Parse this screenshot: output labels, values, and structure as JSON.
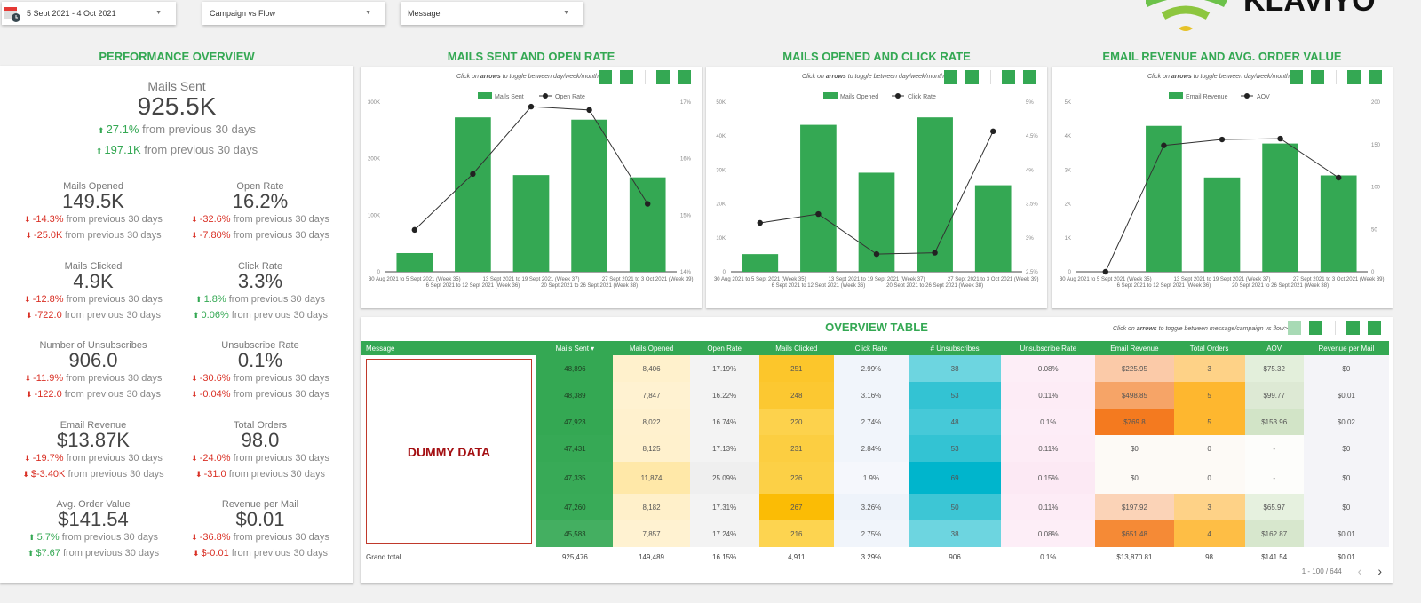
{
  "filters": {
    "date_range": "5 Sept 2021 - 4 Oct 2021",
    "type": "Campaign vs Flow",
    "message": "Message"
  },
  "logo": {
    "text": "KLAVIYO"
  },
  "performance": {
    "title": "PERFORMANCE OVERVIEW",
    "mails_sent": {
      "label": "Mails Sent",
      "value": "925.5K",
      "changes": [
        {
          "dir": "up",
          "value": "27.1%",
          "text": "from previous 30 days"
        },
        {
          "dir": "up",
          "value": "197.1K",
          "text": "from previous 30 days"
        }
      ]
    },
    "kpis": [
      {
        "label": "Mails Opened",
        "value": "149.5K",
        "changes": [
          {
            "dir": "dn",
            "value": "-14.3%",
            "text": "from previous 30 days"
          },
          {
            "dir": "dn",
            "value": "-25.0K",
            "text": "from previous 30 days"
          }
        ]
      },
      {
        "label": "Open Rate",
        "value": "16.2%",
        "changes": [
          {
            "dir": "dn",
            "value": "-32.6%",
            "text": "from previous 30 days"
          },
          {
            "dir": "dn",
            "value": "-7.80%",
            "text": "from previous 30 days"
          }
        ]
      },
      {
        "label": "Mails Clicked",
        "value": "4.9K",
        "changes": [
          {
            "dir": "dn",
            "value": "-12.8%",
            "text": "from previous 30 days"
          },
          {
            "dir": "dn",
            "value": "-722.0",
            "text": "from previous 30 days"
          }
        ]
      },
      {
        "label": "Click Rate",
        "value": "3.3%",
        "changes": [
          {
            "dir": "up",
            "value": "1.8%",
            "text": "from previous 30 days"
          },
          {
            "dir": "up",
            "value": "0.06%",
            "text": "from previous 30 days"
          }
        ]
      },
      {
        "label": "Number of Unsubscribes",
        "value": "906.0",
        "changes": [
          {
            "dir": "dn",
            "value": "-11.9%",
            "text": "from previous 30 days"
          },
          {
            "dir": "dn",
            "value": "-122.0",
            "text": "from previous 30 days"
          }
        ]
      },
      {
        "label": "Unsubscribe Rate",
        "value": "0.1%",
        "changes": [
          {
            "dir": "dn",
            "value": "-30.6%",
            "text": "from previous 30 days"
          },
          {
            "dir": "dn",
            "value": "-0.04%",
            "text": "from previous 30 days"
          }
        ]
      },
      {
        "label": "Email Revenue",
        "value": "$13.87K",
        "changes": [
          {
            "dir": "dn",
            "value": "-19.7%",
            "text": "from previous 30 days"
          },
          {
            "dir": "dn",
            "value": "$-3.40K",
            "text": "from previous 30 days"
          }
        ]
      },
      {
        "label": "Total Orders",
        "value": "98.0",
        "changes": [
          {
            "dir": "dn",
            "value": "-24.0%",
            "text": "from previous 30 days"
          },
          {
            "dir": "dn",
            "value": "-31.0",
            "text": "from previous 30 days"
          }
        ]
      },
      {
        "label": "Avg. Order Value",
        "value": "$141.54",
        "changes": [
          {
            "dir": "up",
            "value": "5.7%",
            "text": "from previous 30 days"
          },
          {
            "dir": "up",
            "value": "$7.67",
            "text": "from previous 30 days"
          }
        ]
      },
      {
        "label": "Revenue per Mail",
        "value": "$0.01",
        "changes": [
          {
            "dir": "dn",
            "value": "-36.8%",
            "text": "from previous 30 days"
          },
          {
            "dir": "dn",
            "value": "$-0.01",
            "text": "from previous 30 days"
          }
        ]
      }
    ]
  },
  "chart_hint": {
    "pre": "Click on ",
    "bold": "arrows",
    "post": " to toggle between day/week/month >"
  },
  "chart_data": [
    {
      "type": "bar",
      "title": "MAILS SENT AND OPEN RATE",
      "categories": [
        "30 Aug 2021 to 5 Sept 2021 (Week 35)",
        "6 Sept 2021 to 12 Sept 2021 (Week 36)",
        "13 Sept 2021 to 19 Sept 2021 (Week 37)",
        "20 Sept 2021 to 26 Sept 2021 (Week 38)",
        "27 Sept 2021 to 3 Oct 2021 (Week 39)"
      ],
      "series": [
        {
          "name": "Mails Sent",
          "type": "bar",
          "axis": "left",
          "values": [
            33000,
            273000,
            171000,
            269000,
            167000
          ]
        },
        {
          "name": "Open Rate",
          "type": "line",
          "axis": "right",
          "values": [
            14.74,
            15.73,
            16.92,
            16.86,
            15.2
          ]
        }
      ],
      "y_left": {
        "range": [
          0,
          300000
        ],
        "ticks": [
          "0",
          "100K",
          "200K",
          "300K"
        ]
      },
      "y_right": {
        "range": [
          14,
          17
        ],
        "ticks": [
          "14%",
          "15%",
          "16%",
          "17%"
        ]
      },
      "legend": "top-center",
      "grid": false
    },
    {
      "type": "bar",
      "title": "MAILS OPENED AND CLICK RATE",
      "categories": [
        "30 Aug 2021 to 5 Sept 2021 (Week 35)",
        "6 Sept 2021 to 12 Sept 2021 (Week 36)",
        "13 Sept 2021 to 19 Sept 2021 (Week 37)",
        "20 Sept 2021 to 26 Sept 2021 (Week 38)",
        "27 Sept 2021 to 3 Oct 2021 (Week 39)"
      ],
      "series": [
        {
          "name": "Mails Opened",
          "type": "bar",
          "axis": "left",
          "values": [
            5200,
            43300,
            29200,
            45500,
            25500
          ]
        },
        {
          "name": "Click Rate",
          "type": "line",
          "axis": "right",
          "values": [
            3.22,
            3.35,
            2.76,
            2.78,
            4.57
          ]
        }
      ],
      "y_left": {
        "range": [
          0,
          50000
        ],
        "ticks": [
          "0",
          "10K",
          "20K",
          "30K",
          "40K",
          "50K"
        ]
      },
      "y_right": {
        "range": [
          2.5,
          5
        ],
        "ticks": [
          "2.5%",
          "3%",
          "3.5%",
          "4%",
          "4.5%",
          "5%"
        ]
      },
      "legend": "top-center",
      "grid": false
    },
    {
      "type": "bar",
      "title": "EMAIL REVENUE AND AVG. ORDER VALUE",
      "categories": [
        "30 Aug 2021 to 5 Sept 2021 (Week 35)",
        "6 Sept 2021 to 12 Sept 2021 (Week 36)",
        "13 Sept 2021 to 19 Sept 2021 (Week 37)",
        "20 Sept 2021 to 26 Sept 2021 (Week 38)",
        "27 Sept 2021 to 3 Oct 2021 (Week 39)"
      ],
      "series": [
        {
          "name": "Email Revenue",
          "type": "bar",
          "axis": "left",
          "values": [
            0,
            4300,
            2780,
            3780,
            2840
          ]
        },
        {
          "name": "AOV",
          "type": "line",
          "axis": "right",
          "values": [
            0,
            149,
            156,
            157,
            111
          ]
        }
      ],
      "y_left": {
        "range": [
          0,
          5000
        ],
        "ticks": [
          "0",
          "1K",
          "2K",
          "3K",
          "4K",
          "5K"
        ]
      },
      "y_right": {
        "range": [
          0,
          200
        ],
        "ticks": [
          "0",
          "50",
          "100",
          "150",
          "200"
        ]
      },
      "legend": "top-center",
      "grid": false
    }
  ],
  "table": {
    "title": "OVERVIEW TABLE",
    "hint": {
      "pre": "Click on ",
      "bold": "arrows",
      "post": " to toggle between message/campaign vs flow>"
    },
    "placeholder": "DUMMY DATA",
    "columns": [
      "Message",
      "Mails Sent ▾",
      "Mails Opened",
      "Open Rate",
      "Mails Clicked",
      "Click Rate",
      "# Unsubscribes",
      "Unsubscribe Rate",
      "Email Revenue",
      "Total Orders",
      "AOV",
      "Revenue per Mail"
    ],
    "rows": [
      [
        "",
        "48,896",
        "8,406",
        "17.19%",
        "251",
        "2.99%",
        "38",
        "0.08%",
        "$225.95",
        "3",
        "$75.32",
        "$0"
      ],
      [
        "",
        "48,389",
        "7,847",
        "16.22%",
        "248",
        "3.16%",
        "53",
        "0.11%",
        "$498.85",
        "5",
        "$99.77",
        "$0.01"
      ],
      [
        "",
        "47,923",
        "8,022",
        "16.74%",
        "220",
        "2.74%",
        "48",
        "0.1%",
        "$769.8",
        "5",
        "$153.96",
        "$0.02"
      ],
      [
        "",
        "47,431",
        "8,125",
        "17.13%",
        "231",
        "2.84%",
        "53",
        "0.11%",
        "$0",
        "0",
        "-",
        "$0"
      ],
      [
        "",
        "47,335",
        "11,874",
        "25.09%",
        "226",
        "1.9%",
        "69",
        "0.15%",
        "$0",
        "0",
        "-",
        "$0"
      ],
      [
        "",
        "47,260",
        "8,182",
        "17.31%",
        "267",
        "3.26%",
        "50",
        "0.11%",
        "$197.92",
        "3",
        "$65.97",
        "$0"
      ],
      [
        "",
        "45,583",
        "7,857",
        "17.24%",
        "216",
        "2.75%",
        "38",
        "0.08%",
        "$651.48",
        "4",
        "$162.87",
        "$0.01"
      ]
    ],
    "grand_total": [
      "Grand total",
      "925,476",
      "149,489",
      "16.15%",
      "4,911",
      "3.29%",
      "906",
      "0.1%",
      "$13,870.81",
      "98",
      "$141.54",
      "$0.01"
    ],
    "pagination": {
      "range": "1 - 100 / 644",
      "prev": "‹",
      "next": "›"
    }
  },
  "colors": {
    "accent": "#34a853",
    "up": "#34a853",
    "down": "#d93025"
  }
}
